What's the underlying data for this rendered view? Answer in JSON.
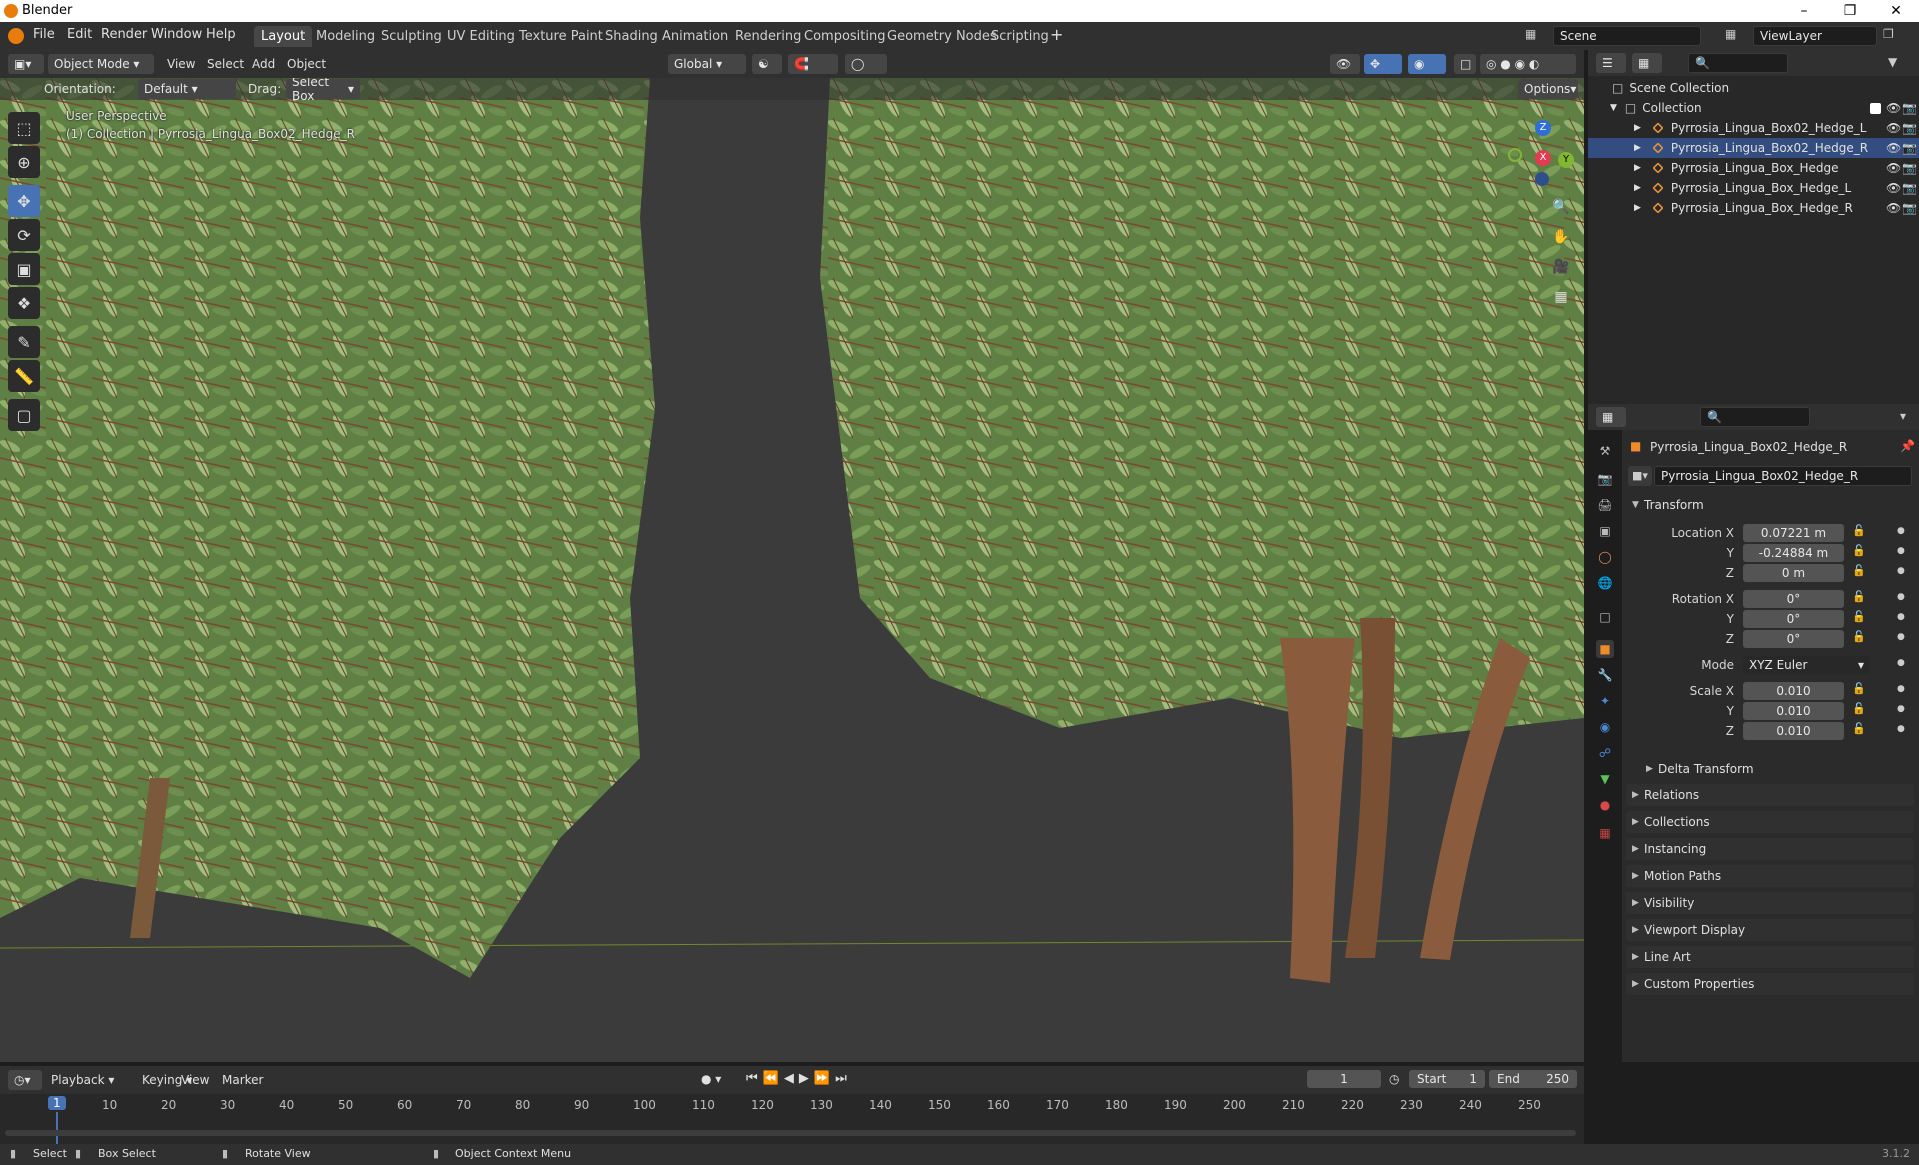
{
  "app": {
    "title": "Blender",
    "version": "3.1.2"
  },
  "menus": [
    "File",
    "Edit",
    "Render",
    "Window",
    "Help"
  ],
  "workspaces": [
    "Layout",
    "Modeling",
    "Sculpting",
    "UV Editing",
    "Texture Paint",
    "Shading",
    "Animation",
    "Rendering",
    "Compositing",
    "Geometry Nodes",
    "Scripting"
  ],
  "active_workspace": "Layout",
  "scene": "Scene",
  "viewlayer": "ViewLayer",
  "viewport": {
    "mode": "Object Mode",
    "menus": [
      "View",
      "Select",
      "Add",
      "Object"
    ],
    "transform_orientation": "Global",
    "orientation_label": "Orientation:",
    "orientation_value": "Default",
    "drag_label": "Drag:",
    "drag_value": "Select Box",
    "options": "Options",
    "info_line1": "User Perspective",
    "info_line2": "(1) Collection | Pyrrosia_Lingua_Box02_Hedge_R",
    "axes": {
      "x": "X",
      "y": "Y",
      "z": "Z"
    }
  },
  "outliner": {
    "root": "Scene Collection",
    "collection": "Collection",
    "items": [
      "Pyrrosia_Lingua_Box02_Hedge_L",
      "Pyrrosia_Lingua_Box02_Hedge_R",
      "Pyrrosia_Lingua_Box_Hedge",
      "Pyrrosia_Lingua_Box_Hedge_L",
      "Pyrrosia_Lingua_Box_Hedge_R"
    ],
    "selected_index": 1
  },
  "properties": {
    "object_name": "Pyrrosia_Lingua_Box02_Hedge_R",
    "name_field": "Pyrrosia_Lingua_Box02_Hedge_R",
    "transform_title": "Transform",
    "location_label": "Location X",
    "location": [
      "0.07221 m",
      "-0.24884 m",
      "0 m"
    ],
    "rotation_label": "Rotation X",
    "rotation": [
      "0°",
      "0°",
      "0°"
    ],
    "mode_label": "Mode",
    "mode": "XYZ Euler",
    "scale_label": "Scale X",
    "scale": [
      "0.010",
      "0.010",
      "0.010"
    ],
    "y": "Y",
    "z": "Z",
    "delta": "Delta Transform",
    "panels": [
      "Relations",
      "Collections",
      "Instancing",
      "Motion Paths",
      "Visibility",
      "Viewport Display",
      "Line Art",
      "Custom Properties"
    ]
  },
  "timeline": {
    "menus": [
      "Playback",
      "Keying",
      "View",
      "Marker"
    ],
    "current_frame": "1",
    "start_label": "Start",
    "start": "1",
    "end_label": "End",
    "end": "250",
    "ticks": [
      "1",
      "10",
      "20",
      "30",
      "40",
      "50",
      "60",
      "70",
      "80",
      "90",
      "100",
      "110",
      "120",
      "130",
      "140",
      "150",
      "160",
      "170",
      "180",
      "190",
      "200",
      "210",
      "220",
      "230",
      "240",
      "250"
    ]
  },
  "status": {
    "select": "Select",
    "box_select": "Box Select",
    "rotate_view": "Rotate View",
    "context_menu": "Object Context Menu"
  },
  "colors": {
    "accent": "#4772b3",
    "foliage": "#6f8f4f",
    "selected_row": "#334d80"
  }
}
